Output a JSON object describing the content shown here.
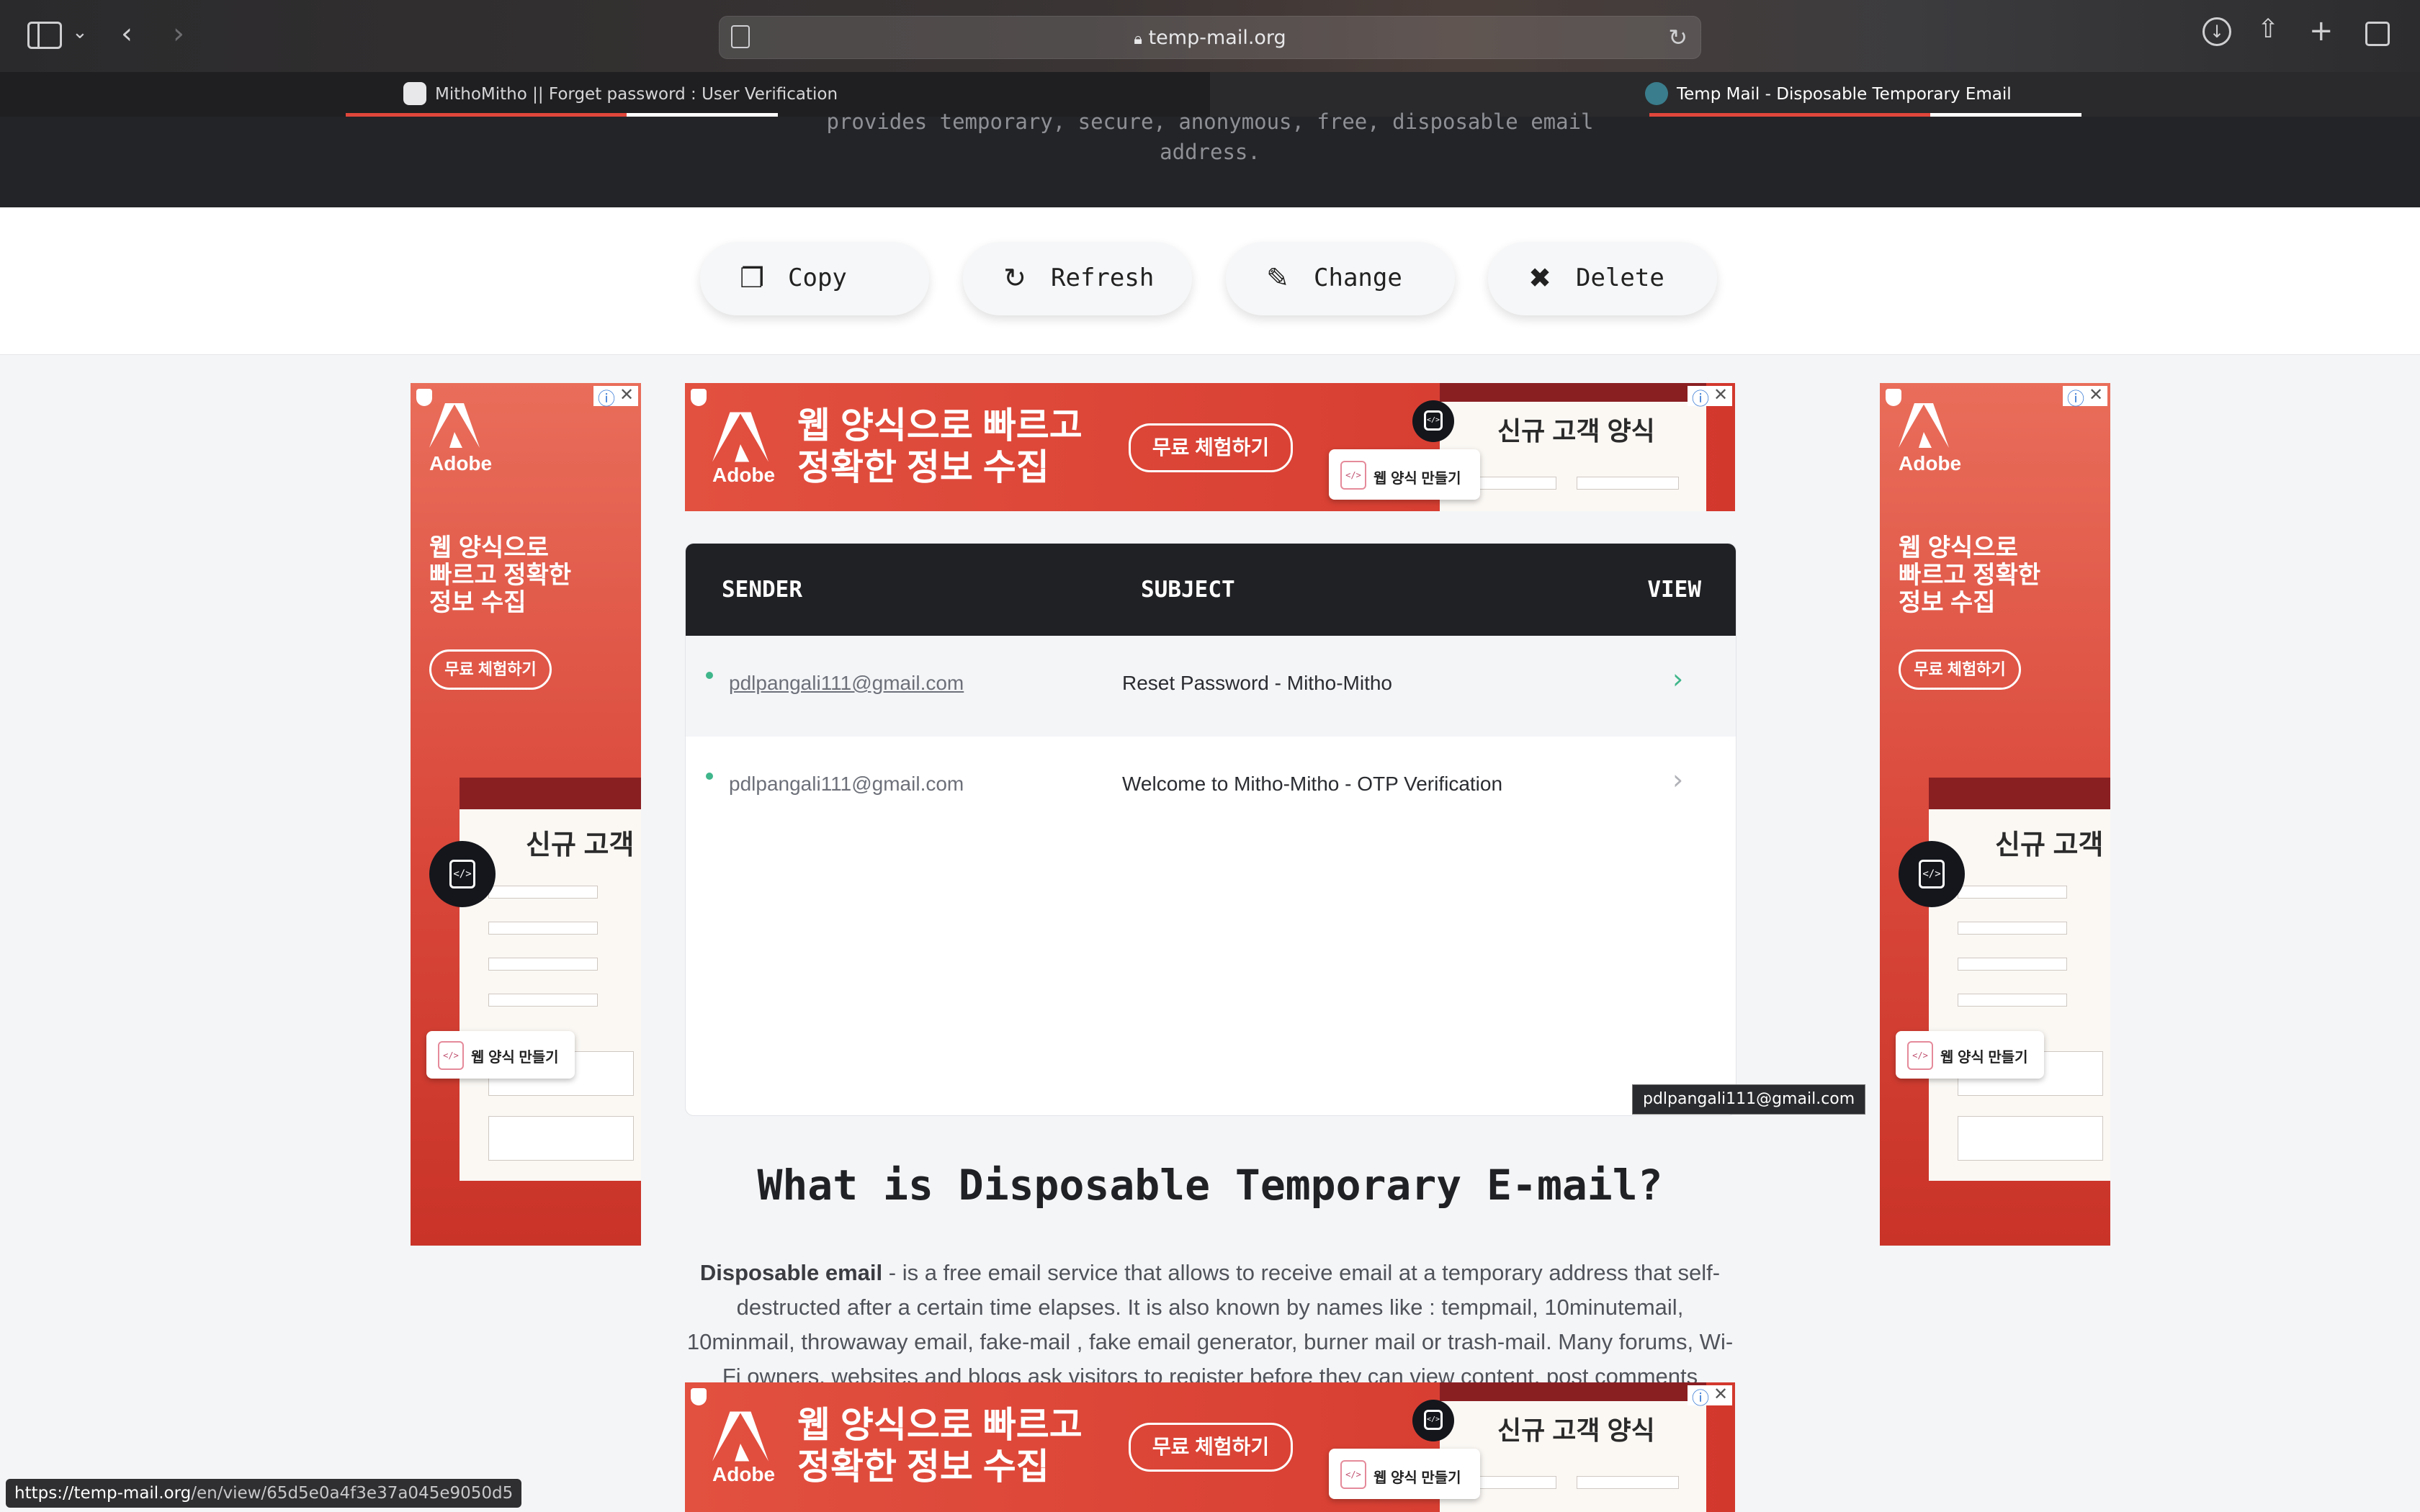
{
  "browser": {
    "url": "temp-mail.org",
    "tabs": [
      {
        "title": "MithoMitho || Forget password : User Verification"
      },
      {
        "title": "Temp Mail - Disposable Temporary Email"
      }
    ]
  },
  "header": {
    "tagline_line1": "provides temporary, secure, anonymous, free, disposable email",
    "tagline_line2": "address."
  },
  "actions": {
    "copy": "Copy",
    "refresh": "Refresh",
    "change": "Change",
    "delete": "Delete"
  },
  "ads": {
    "brand": "Adobe",
    "banner_headline_1": "웹 양식으로 빠르고",
    "banner_headline_2": "정확한 정보 수집",
    "side_headline_1": "웹 양식으로",
    "side_headline_2": "빠르고 정확한",
    "side_headline_3": "정보 수집",
    "cta": "무료 체험하기",
    "form_title_banner": "신규 고객 양식",
    "form_title_side": "신규 고객",
    "chip_label": "웹 양식 만들기"
  },
  "inbox": {
    "columns": {
      "sender": "SENDER",
      "subject": "SUBJECT",
      "view": "VIEW"
    },
    "rows": [
      {
        "sender": "pdlpangali111@gmail.com",
        "subject": "Reset Password - Mitho-Mitho"
      },
      {
        "sender": "pdlpangali111@gmail.com",
        "subject": "Welcome to Mitho-Mitho - OTP Verification"
      }
    ],
    "tooltip": "pdlpangali111@gmail.com"
  },
  "article": {
    "title": "What is Disposable Temporary E-mail?",
    "lead": "Disposable email",
    "body": " - is a free email service that allows to receive email at a temporary address that self-destructed after a certain time elapses. It is also known by names like : tempmail, 10minutemail, 10minmail, throwaway email, fake-mail , fake email generator, burner mail or trash-mail. Many forums, Wi-Fi owners, websites and blogs ask visitors to register before they can view content, post comments"
  },
  "status_bar": {
    "host": "https://temp-mail.org",
    "path": "/en/view/65d5e0a4f3e37a045e9050d5"
  },
  "colors": {
    "ad_red": "#d9473a",
    "inbox_head": "#202124",
    "unread_dot": "#3fb68b"
  }
}
